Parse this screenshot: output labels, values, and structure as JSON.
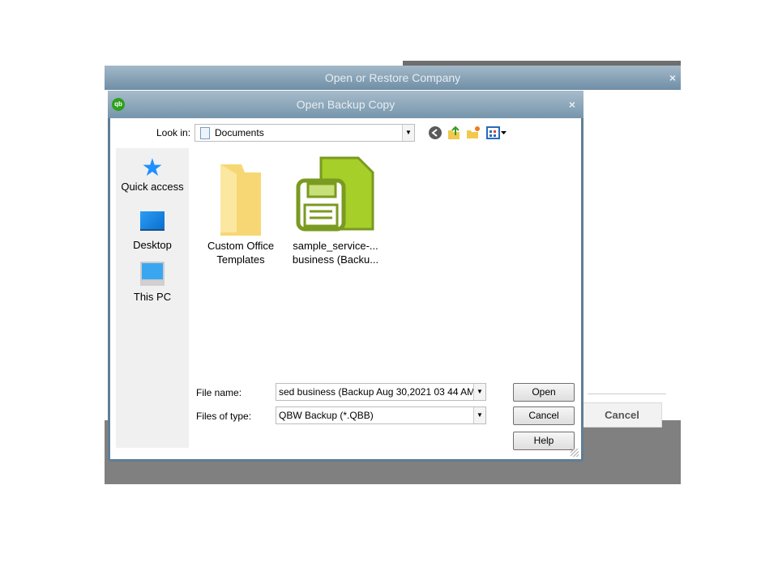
{
  "outer_window": {
    "title": "Open or Restore Company",
    "close": "×",
    "cancel_label": "Cancel"
  },
  "dialog": {
    "title": "Open Backup Copy",
    "logo": "qb",
    "close": "×",
    "look_in": {
      "label": "Look in:",
      "value": "Documents"
    },
    "toolbar_icons": [
      "back-icon",
      "up-folder-icon",
      "new-folder-icon",
      "view-menu-icon"
    ],
    "places": [
      {
        "label": "Quick access",
        "icon": "star-icon"
      },
      {
        "label": "Desktop",
        "icon": "desktop-icon"
      },
      {
        "label": "This PC",
        "icon": "computer-icon"
      }
    ],
    "files": [
      {
        "line1": "Custom Office",
        "line2": "Templates",
        "icon": "folder-icon"
      },
      {
        "line1": "sample_service-...",
        "line2": "business (Backu...",
        "icon": "qb-backup-file-icon"
      }
    ],
    "file_name": {
      "label": "File name:",
      "value": "sed business (Backup Aug 30,2021  03 44 AM)"
    },
    "file_type": {
      "label": "Files of type:",
      "value": "QBW Backup (*.QBB)"
    },
    "buttons": {
      "open": "Open",
      "cancel": "Cancel",
      "help": "Help"
    }
  }
}
